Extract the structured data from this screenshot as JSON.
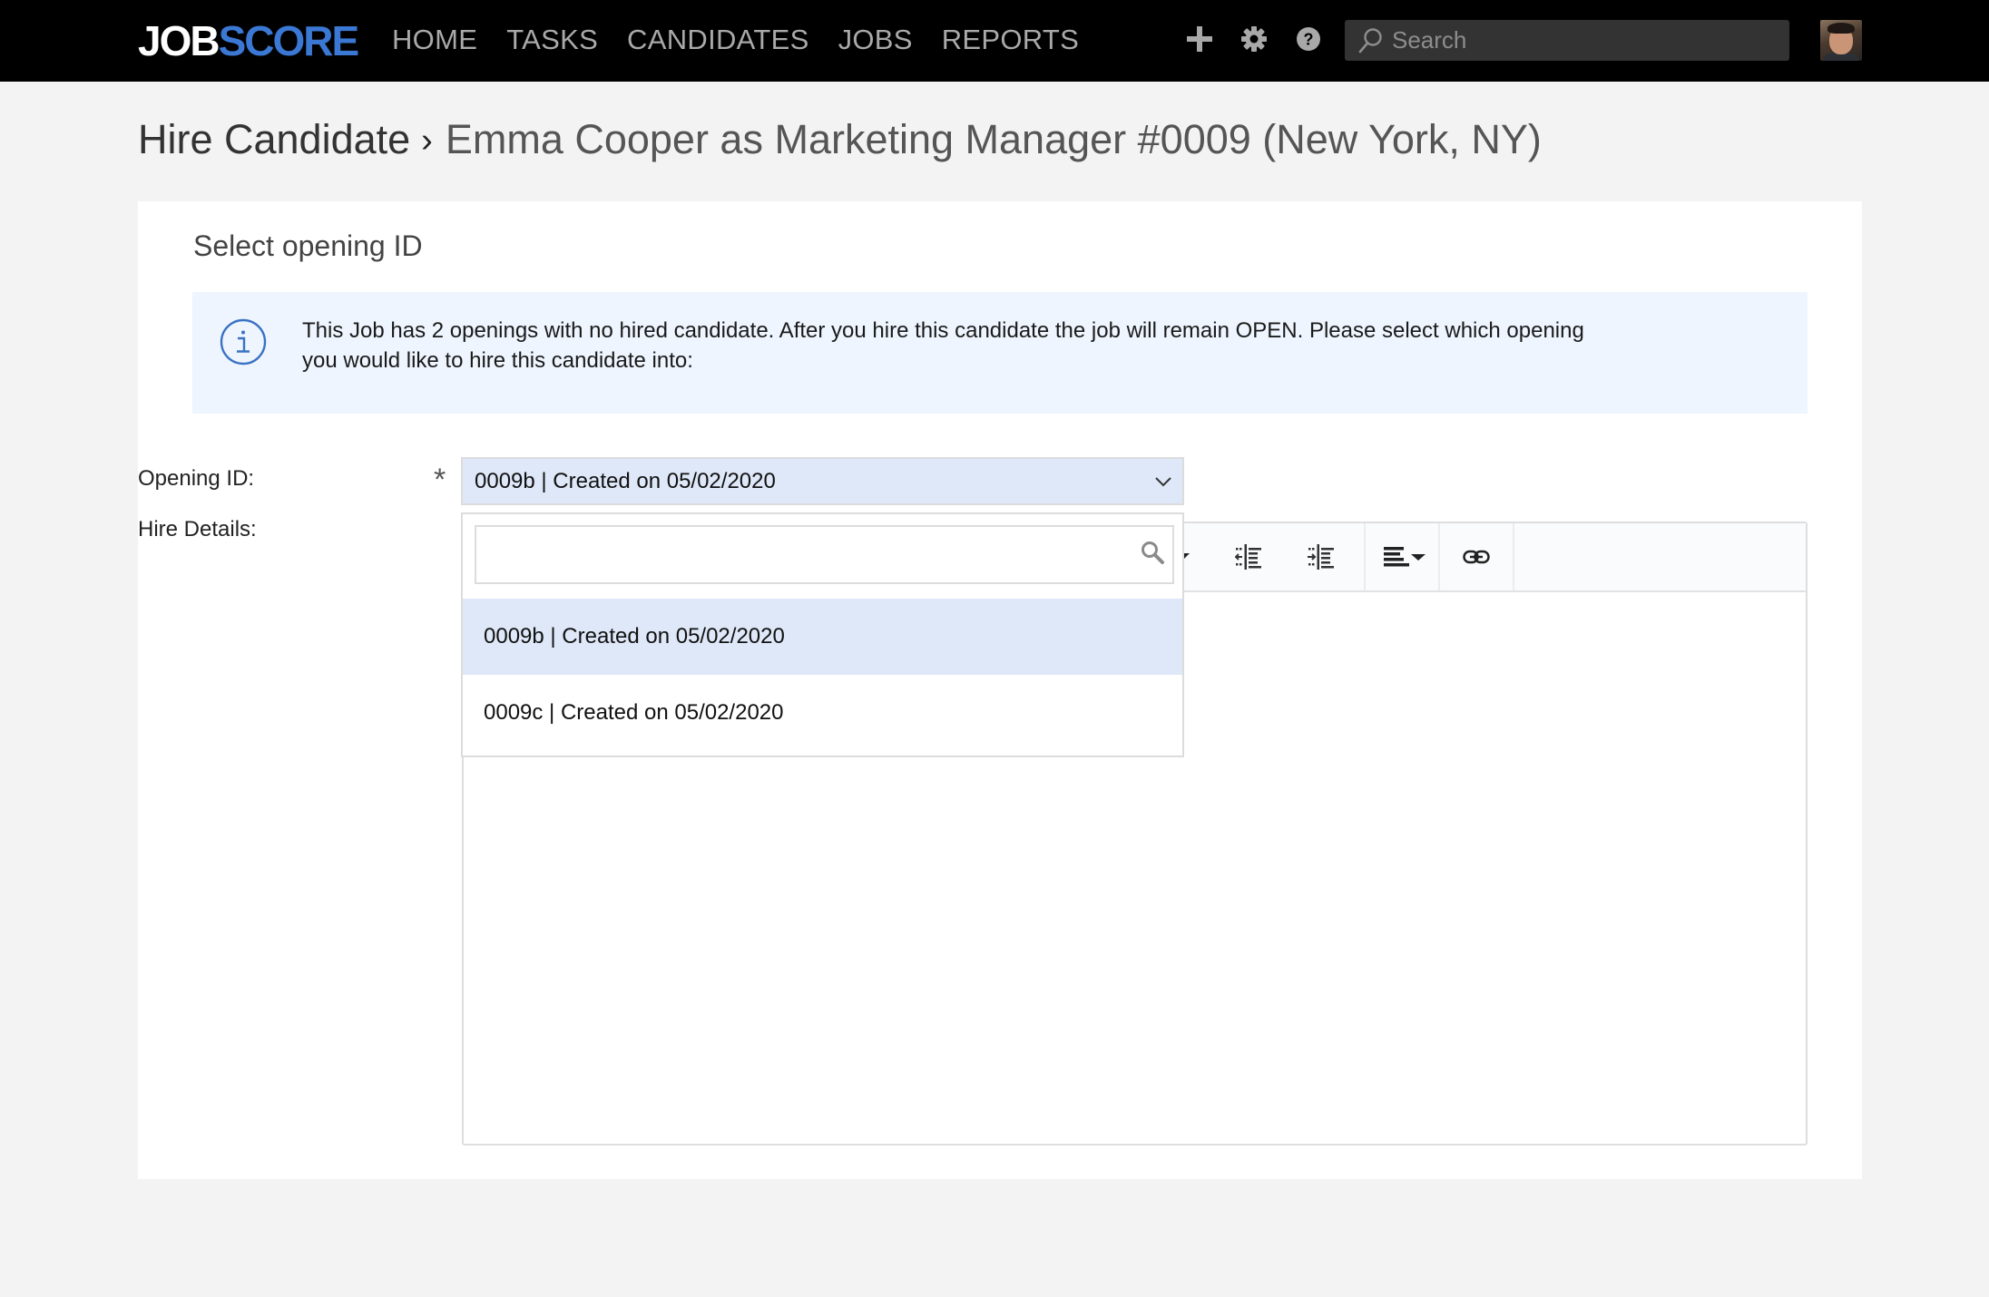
{
  "app": {
    "logo_part1": "JOB",
    "logo_part2": "SCORE",
    "brand_color": "#3a78d4"
  },
  "nav": {
    "items": [
      {
        "label": "HOME"
      },
      {
        "label": "TASKS"
      },
      {
        "label": "CANDIDATES"
      },
      {
        "label": "JOBS"
      },
      {
        "label": "REPORTS"
      }
    ],
    "icons": [
      "plus-icon",
      "gear-icon",
      "help-icon"
    ],
    "search_placeholder": "Search"
  },
  "page": {
    "breadcrumb_root": "Hire Candidate",
    "breadcrumb_separator": "›",
    "breadcrumb_current": "Emma Cooper as Marketing Manager #0009 (New York, NY)"
  },
  "form": {
    "section_title": "Select opening ID",
    "info_message": "This Job has 2 openings with no hired candidate. After you hire this candidate the job will remain OPEN. Please select which opening you would like to hire this candidate into:",
    "opening_id_label": "Opening ID:",
    "required_marker": "*",
    "opening_id_value": "0009b | Created on 05/02/2020",
    "hire_details_label": "Hire Details:",
    "dropdown": {
      "search_value": "",
      "options": [
        {
          "label": "0009b | Created on 05/02/2020",
          "selected": true
        },
        {
          "label": "0009c | Created on 05/02/2020",
          "selected": false
        }
      ]
    },
    "editor_toolbar": [
      "dropdown-caret",
      "outdent",
      "indent",
      "align-left",
      "link"
    ],
    "editor_content": ""
  }
}
